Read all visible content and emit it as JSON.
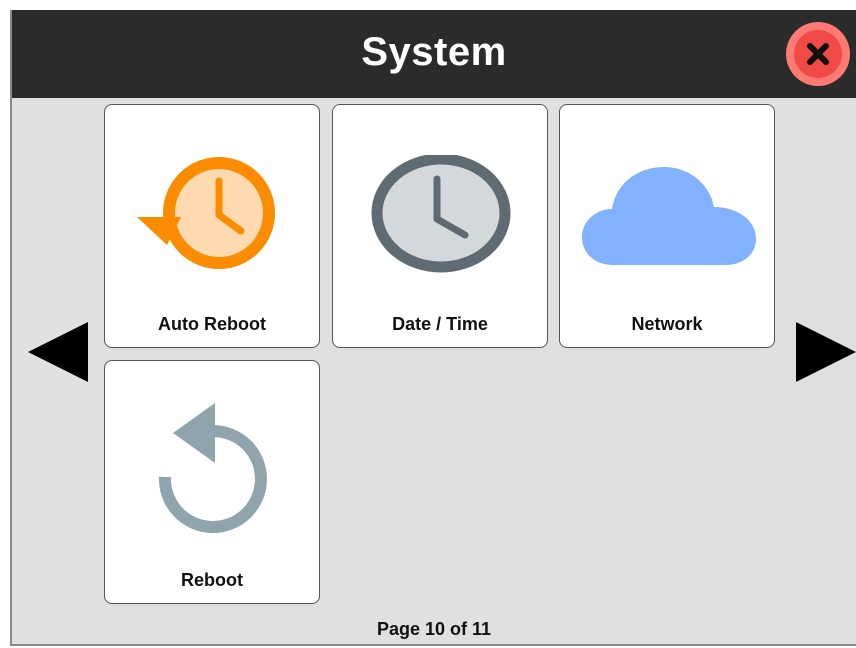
{
  "header": {
    "title": "System"
  },
  "tiles": [
    {
      "label": "Auto Reboot",
      "icon": "auto-reboot-clock-icon",
      "color": "#fb8c00"
    },
    {
      "label": "Date / Time",
      "icon": "clock-icon",
      "color": "#5f6b73"
    },
    {
      "label": "Network",
      "icon": "cloud-icon",
      "color": "#82b1ff"
    },
    {
      "label": "Reboot",
      "icon": "reboot-arrow-icon",
      "color": "#90a4ae"
    }
  ],
  "pagination": {
    "text": "Page 10 of 11",
    "current": 10,
    "total": 11
  },
  "colors": {
    "header_bg": "#2b2b2b",
    "panel_bg": "#e0e0e0",
    "close": "#ef4a45"
  }
}
